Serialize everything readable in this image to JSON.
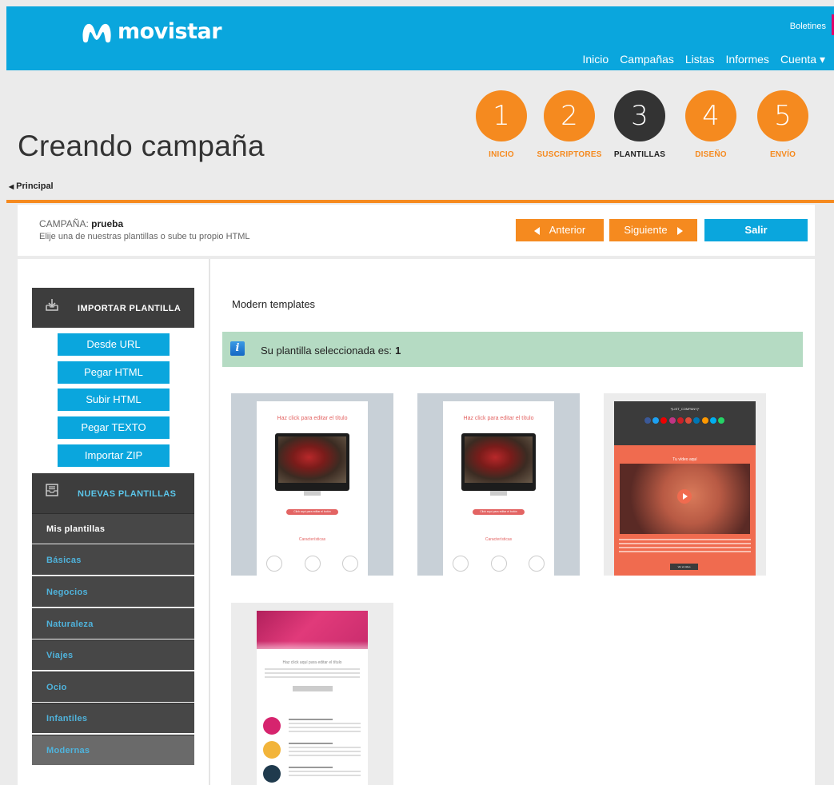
{
  "header": {
    "brand": "movistar",
    "top_right": "Boletines",
    "nav": [
      "Inicio",
      "Campañas",
      "Listas",
      "Informes",
      "Cuenta ▾"
    ],
    "active_nav": "Campañas"
  },
  "page": {
    "title": "Creando campaña",
    "breadcrumb": "Principal"
  },
  "steps": [
    {
      "num": "1",
      "label": "INICIO"
    },
    {
      "num": "2",
      "label": "SUSCRIPTORES"
    },
    {
      "num": "3",
      "label": "PLANTILLAS"
    },
    {
      "num": "4",
      "label": "DISEÑO"
    },
    {
      "num": "5",
      "label": "ENVÍO"
    }
  ],
  "current_step": 3,
  "campaign": {
    "label": "CAMPAÑA:",
    "name": "prueba",
    "subtitle": "Elije una de nuestras plantillas o sube tu propio HTML",
    "btn_prev": "Anterior",
    "btn_next": "Siguiente",
    "btn_exit": "Salir"
  },
  "sidebar": {
    "import_header": "IMPORTAR PLANTILLA",
    "import_buttons": [
      "Desde URL",
      "Pegar HTML",
      "Subir HTML",
      "Pegar TEXTO",
      "Importar ZIP"
    ],
    "new_header": "NUEVAS PLANTILLAS",
    "categories": [
      "Mis plantillas",
      "Básicas",
      "Negocios",
      "Naturaleza",
      "Viajes",
      "Ocio",
      "Infantiles",
      "Modernas"
    ],
    "active_category": "Modernas"
  },
  "main": {
    "section_title": "Modern templates",
    "alert_text": "Su plantilla seleccionada es:",
    "selected_number": "1"
  },
  "templates": [
    {
      "title": "Haz click para editar el título",
      "button": "Click aquí para editar el botón",
      "feature": "Características"
    },
    {
      "title": "Haz click para editar el título",
      "button": "Click aquí para editar el botón",
      "feature": "Características"
    },
    {
      "company": "*|LIST_COMPANY|*",
      "video_title": "Tu vídeo aquí",
      "button": "Ver el vídeo"
    },
    {
      "title": "Haz click aquí para editar el título",
      "row_heading": "HAZ CLICK AQUÍ PARA EDITAR EL TÍTULO"
    }
  ],
  "colors": {
    "brand_blue": "#0aa6dd",
    "orange": "#f58a1f",
    "dark": "#333333",
    "alert_green": "#b5dbc3"
  }
}
